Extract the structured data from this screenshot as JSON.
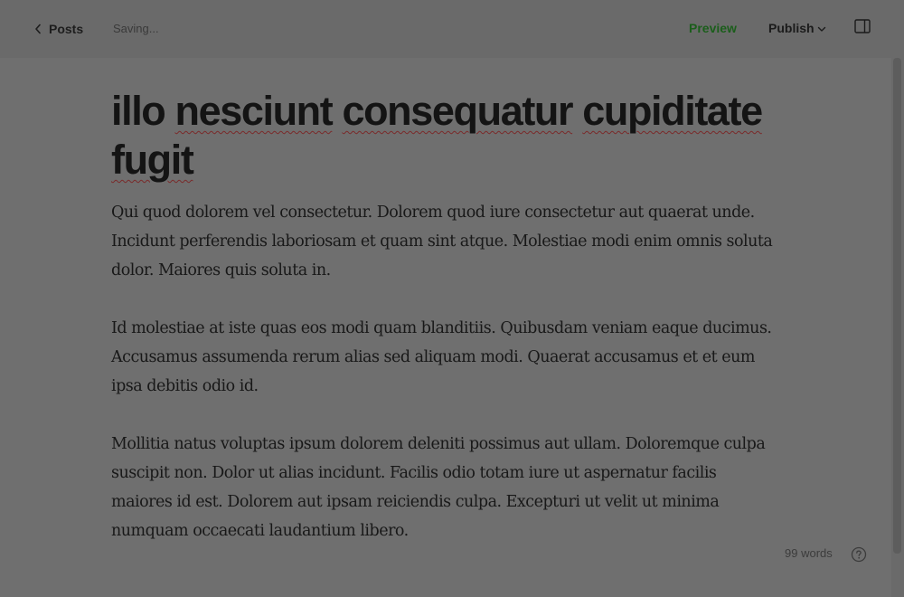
{
  "header": {
    "back_label": "Posts",
    "status_text": "Saving...",
    "preview_label": "Preview",
    "publish_label": "Publish"
  },
  "post": {
    "title_words": [
      "illo",
      "nesciunt",
      "consequatur",
      "cupiditate",
      "fugit"
    ],
    "paragraphs": [
      "Qui quod dolorem vel consectetur. Dolorem quod iure consectetur aut quaerat unde. Incidunt perferendis laboriosam et quam sint atque. Molestiae modi enim omnis soluta dolor. Maiores quis soluta in.",
      "Id molestiae at iste quas eos modi quam blanditiis. Quibusdam veniam eaque ducimus. Accusamus assumenda rerum alias sed aliquam modi. Quaerat accusamus et et eum ipsa debitis odio id.",
      "Mollitia natus voluptas ipsum dolorem deleniti possimus aut ullam. Doloremque culpa suscipit non. Dolor ut alias incidunt. Facilis odio totam iure ut aspernatur facilis maiores id est. Dolorem aut ipsam reiciendis culpa. Excepturi ut velit ut minima numquam occaecati laudantium libero."
    ]
  },
  "footer": {
    "word_count": "99 words"
  },
  "icons": {
    "back": "chevron-left-icon",
    "publish_caret": "chevron-down-icon",
    "sidebar": "sidebar-panel-icon",
    "help": "question-circle-icon"
  },
  "colors": {
    "overlay_background": "#6f6f6f",
    "preview_accent": "#1b5e1b",
    "spellcheck_underline": "#7a2a2a"
  }
}
